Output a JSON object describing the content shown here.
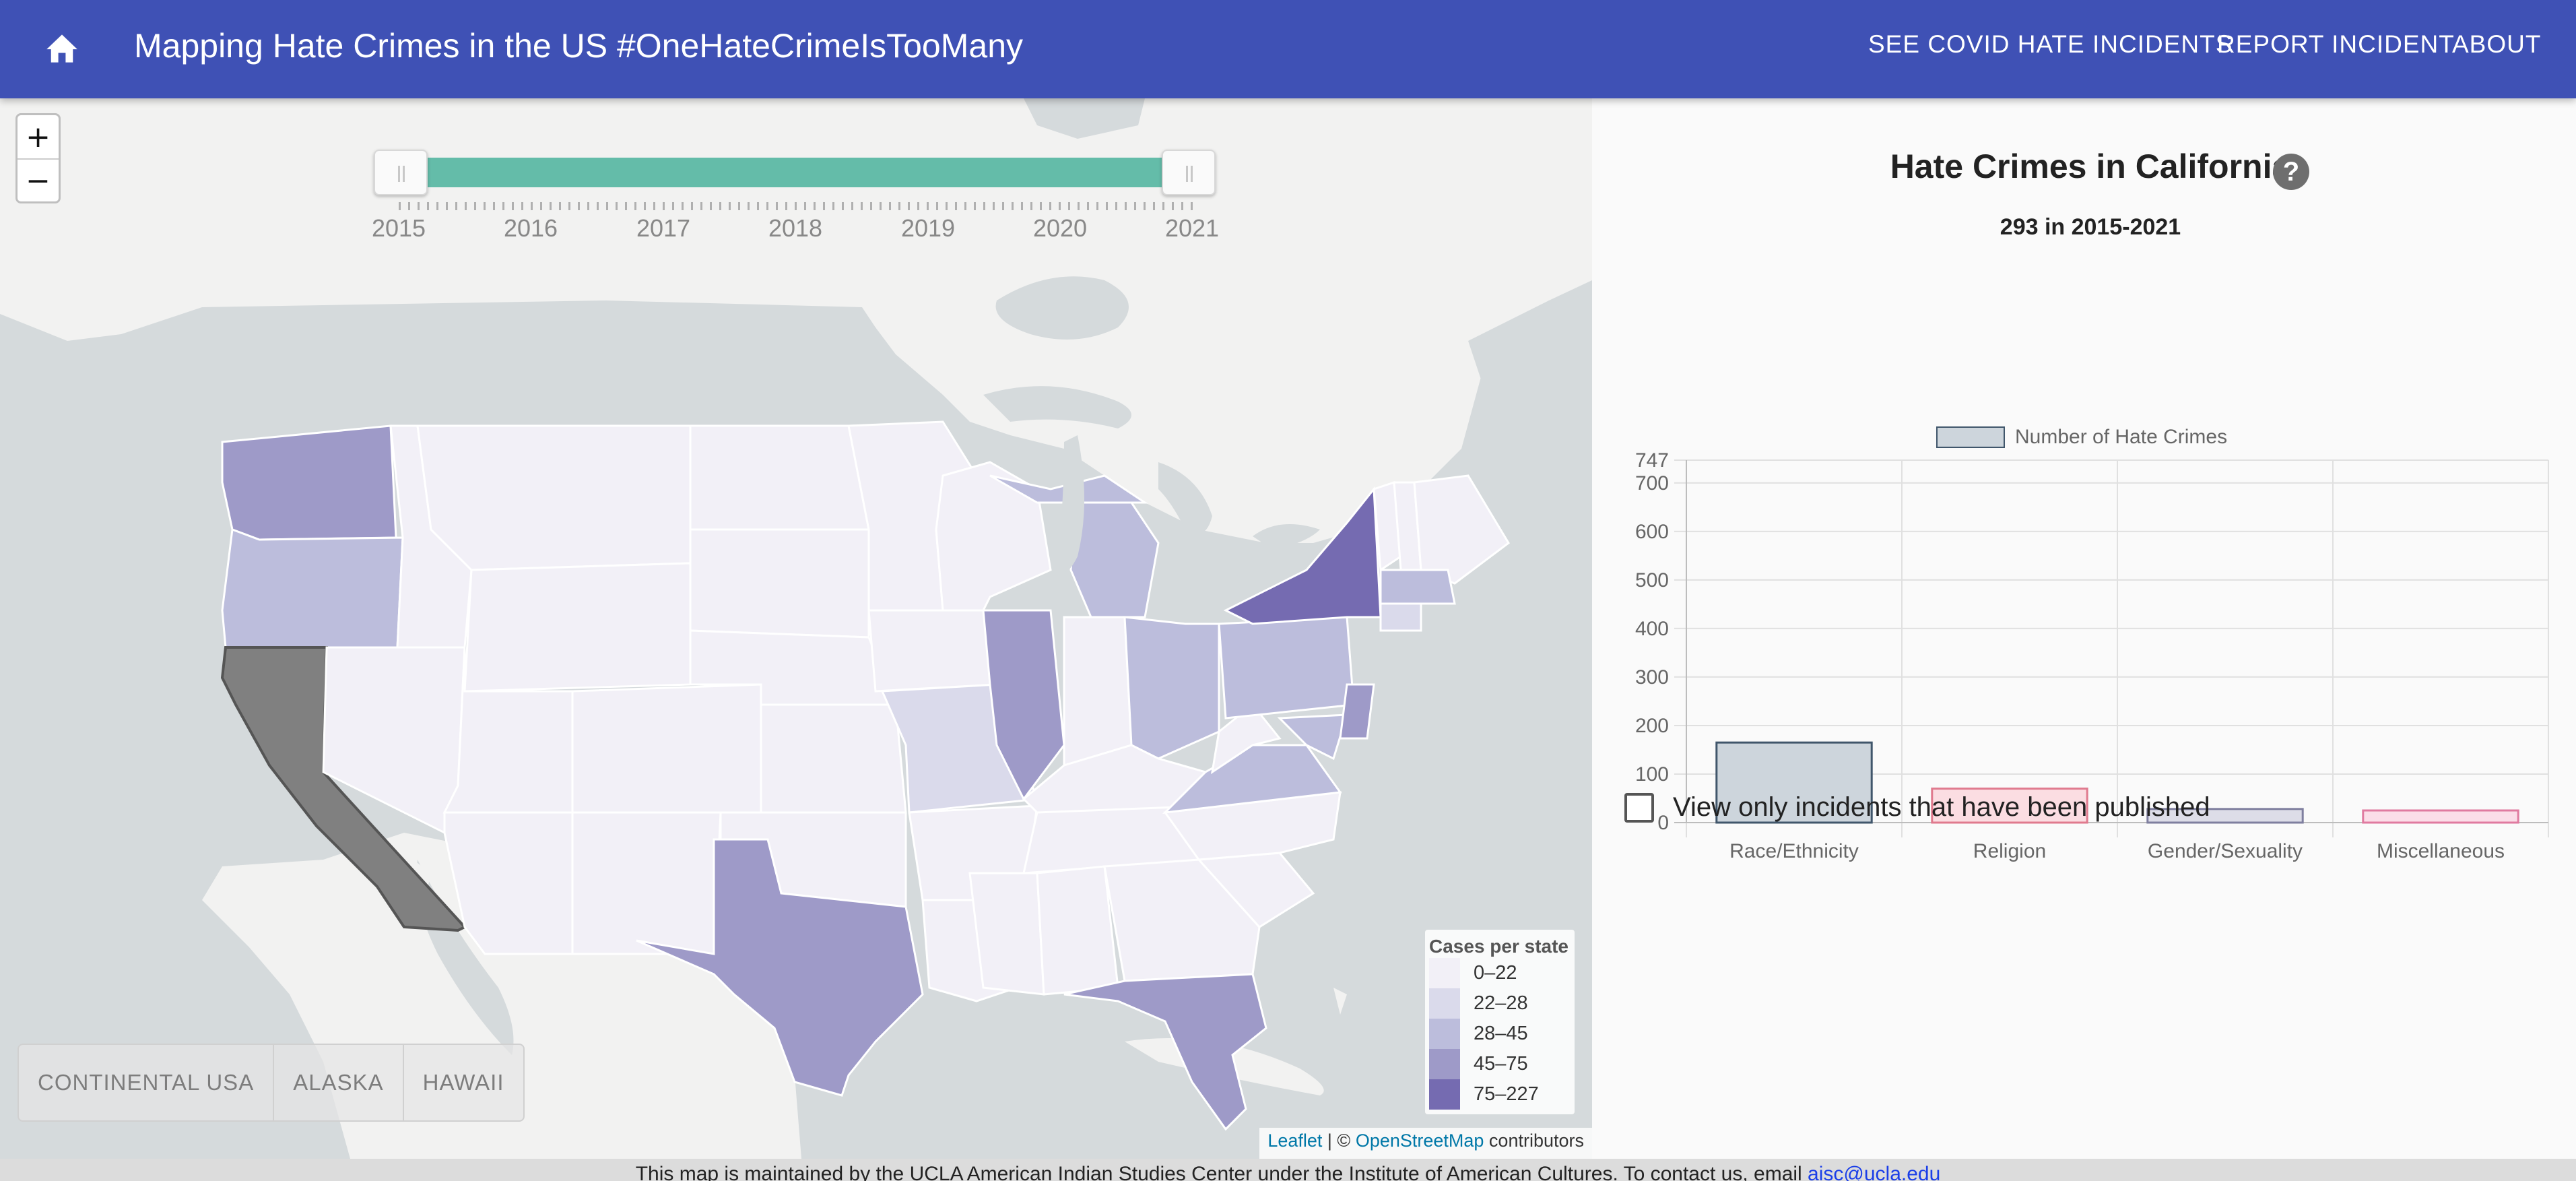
{
  "appbar": {
    "title": "Mapping Hate Crimes in the US #OneHateCrimeIsTooMany",
    "nav": [
      {
        "label": "SEE COVID HATE INCIDENTS"
      },
      {
        "label": "REPORT INCIDENT"
      },
      {
        "label": "ABOUT"
      }
    ],
    "color": "#3f51b5"
  },
  "map": {
    "zoom_in_label": "+",
    "zoom_out_label": "−",
    "slider": {
      "years": [
        "2015",
        "2016",
        "2017",
        "2018",
        "2019",
        "2020",
        "2021"
      ],
      "selected_range": [
        "2015",
        "2021"
      ]
    },
    "regions": [
      {
        "label": "CONTINENTAL USA"
      },
      {
        "label": "ALASKA"
      },
      {
        "label": "HAWAII"
      }
    ],
    "legend": {
      "title": "Cases per state",
      "items": [
        {
          "label": "0–22",
          "color": "#f2f0f7"
        },
        {
          "label": "22–28",
          "color": "#dadaeb"
        },
        {
          "label": "28–45",
          "color": "#bcbddc"
        },
        {
          "label": "45–75",
          "color": "#9e9ac8"
        },
        {
          "label": "75–227",
          "color": "#756bb1"
        }
      ]
    },
    "selected_state_color": "#808080",
    "attribution": {
      "leaflet": "Leaflet",
      "separator": " | © ",
      "osm": "OpenStreetMap",
      "suffix": " contributors"
    }
  },
  "panel": {
    "title": "Hate Crimes in California",
    "subtitle": "293 in 2015-2021",
    "help_icon": "question-icon",
    "published_label": "View only incidents that have been published"
  },
  "chart_data": {
    "type": "bar",
    "categories": [
      "Race/Ethnicity",
      "Religion",
      "Gender/Sexuality",
      "Miscellaneous"
    ],
    "series": [
      {
        "name": "Number of Hate Crimes",
        "values": [
          165,
          70,
          28,
          25
        ]
      }
    ],
    "bar_fills": [
      "#cdd5dc",
      "#fbdde2",
      "#dddde8",
      "#fbdde8"
    ],
    "bar_strokes": [
      "#40566b",
      "#e07a8e",
      "#7f7f9f",
      "#e07aa0"
    ],
    "legend_swatch": {
      "fill": "#cdd5dc",
      "stroke": "#40566b"
    },
    "yticks": [
      0,
      100,
      200,
      300,
      400,
      500,
      600,
      700,
      747
    ],
    "ylim": [
      0,
      747
    ],
    "grid": true,
    "legend_position": "top"
  },
  "footer": {
    "text": "This map is maintained by the UCLA American Indian Studies Center under the Institute of American Cultures. To contact us, email ",
    "email": "aisc@ucla.edu"
  }
}
